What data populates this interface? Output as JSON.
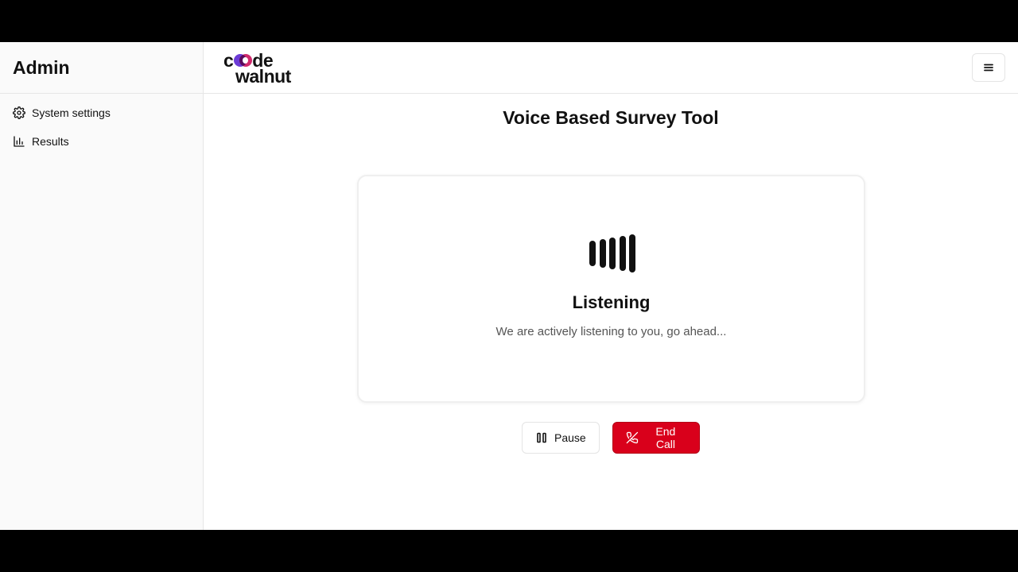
{
  "sidebar": {
    "title": "Admin",
    "items": [
      {
        "label": "System settings",
        "icon": "gear-icon"
      },
      {
        "label": "Results",
        "icon": "bar-chart-icon"
      }
    ]
  },
  "header": {
    "logo_text_line1_prefix": "c",
    "logo_text_line1_suffix": "de",
    "logo_text_line2": "walnut",
    "logo_colors": {
      "left": "#6c3bd6",
      "right": "#d12a6d"
    },
    "menu_icon": "hamburger-menu-icon"
  },
  "page": {
    "title": "Voice Based Survey Tool"
  },
  "status_card": {
    "icon": "audio-waveform-icon",
    "heading": "Listening",
    "subtext": "We are actively listening to you, go ahead..."
  },
  "controls": {
    "pause_label": "Pause",
    "pause_icon": "pause-icon",
    "end_call_label": "End Call",
    "end_call_icon": "phone-off-icon",
    "end_call_color": "#d9001b"
  }
}
